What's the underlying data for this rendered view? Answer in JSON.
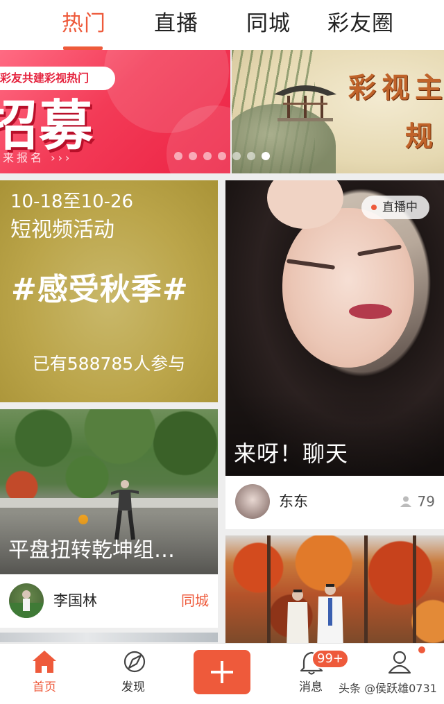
{
  "colors": {
    "accent": "#ee5a3b",
    "text": "#222222",
    "background": "#eeeeee"
  },
  "tabs": [
    {
      "label": "热门",
      "active": true
    },
    {
      "label": "直播",
      "active": false
    },
    {
      "label": "同城",
      "active": false
    },
    {
      "label": "彩友圈",
      "active": false
    }
  ],
  "banner": {
    "slide1": {
      "tagline": "彩友共建彩视热门",
      "headline": "招募",
      "subline": "来报名 ›››"
    },
    "slide2": {
      "title_line1": "彩视主",
      "title_line2": "规"
    },
    "dots_total": 7,
    "active_dot": 7
  },
  "feed": {
    "activity": {
      "date_range": "10-18至10-26",
      "kind": "短视频活动",
      "topic": "#感受秋季#",
      "participants": "已有588785人参与"
    },
    "video1": {
      "title": "平盘扭转乾坤组…",
      "user": "李国林",
      "location_tag": "同城"
    },
    "live": {
      "status_badge": "直播中",
      "title": "来呀！聊天",
      "user": "东东",
      "viewers": "79"
    },
    "video2": {}
  },
  "bottom_nav": {
    "items": [
      {
        "label": "首页",
        "icon": "home-icon",
        "active": true
      },
      {
        "label": "发现",
        "icon": "discover-icon",
        "active": false
      },
      {
        "label": "",
        "icon": "plus-icon",
        "active": false
      },
      {
        "label": "消息",
        "icon": "bell-icon",
        "active": false
      },
      {
        "label": "",
        "icon": "user-icon",
        "active": false
      }
    ],
    "message_badge": "99+"
  },
  "watermark": "头条 @侯跃雄0731"
}
